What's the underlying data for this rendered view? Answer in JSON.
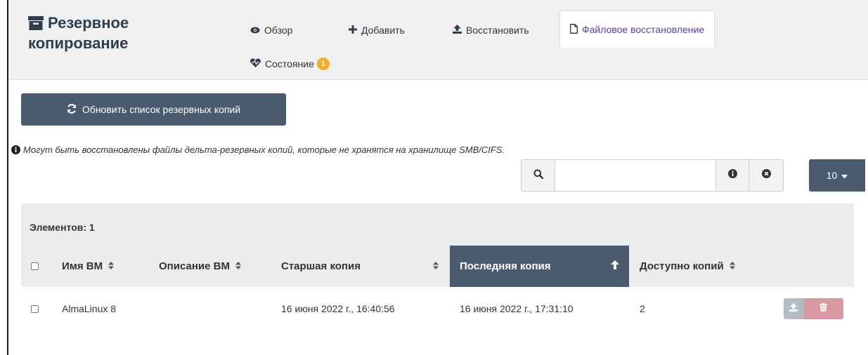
{
  "app": {
    "title_line1": "Резервное",
    "title_line2": "копирование",
    "icon": "archive-icon"
  },
  "tabs": [
    {
      "label": "Обзор",
      "icon": "eye-icon"
    },
    {
      "label": "Добавить",
      "icon": "plus-icon"
    },
    {
      "label": "Восстановить",
      "icon": "upload-icon"
    },
    {
      "label": "Файловое восстановление",
      "icon": "file-icon",
      "active": true
    },
    {
      "label": "Состояние",
      "icon": "heartbeat-icon",
      "badge": "1"
    }
  ],
  "toolbar": {
    "refresh_label": "Обновить список резервных копий"
  },
  "info_note": "Могут быть восстановлены файлы дельта-резервных копий, которые не хранятся на хранилище SMB/CIFS.",
  "search": {
    "value": "",
    "placeholder": ""
  },
  "page_size": "10",
  "table": {
    "count_label": "Элементов: 1",
    "columns": [
      "Имя ВМ",
      "Описание ВМ",
      "Старшая копия",
      "Последняя копия",
      "Доступно копий"
    ],
    "rows": [
      {
        "vm_name": "AlmaLinux 8",
        "vm_description": "",
        "oldest": "16 июня 2022 г., 16:40:56",
        "latest": "16 июня 2022 г., 17:31:10",
        "available": "2"
      }
    ]
  },
  "colors": {
    "primary": "#4a5b70",
    "active_tab_text": "#5b3fa0",
    "badge": "#f0ad2e",
    "restore_disabled": "#b3bcc6",
    "delete_disabled": "#d99aa3"
  }
}
